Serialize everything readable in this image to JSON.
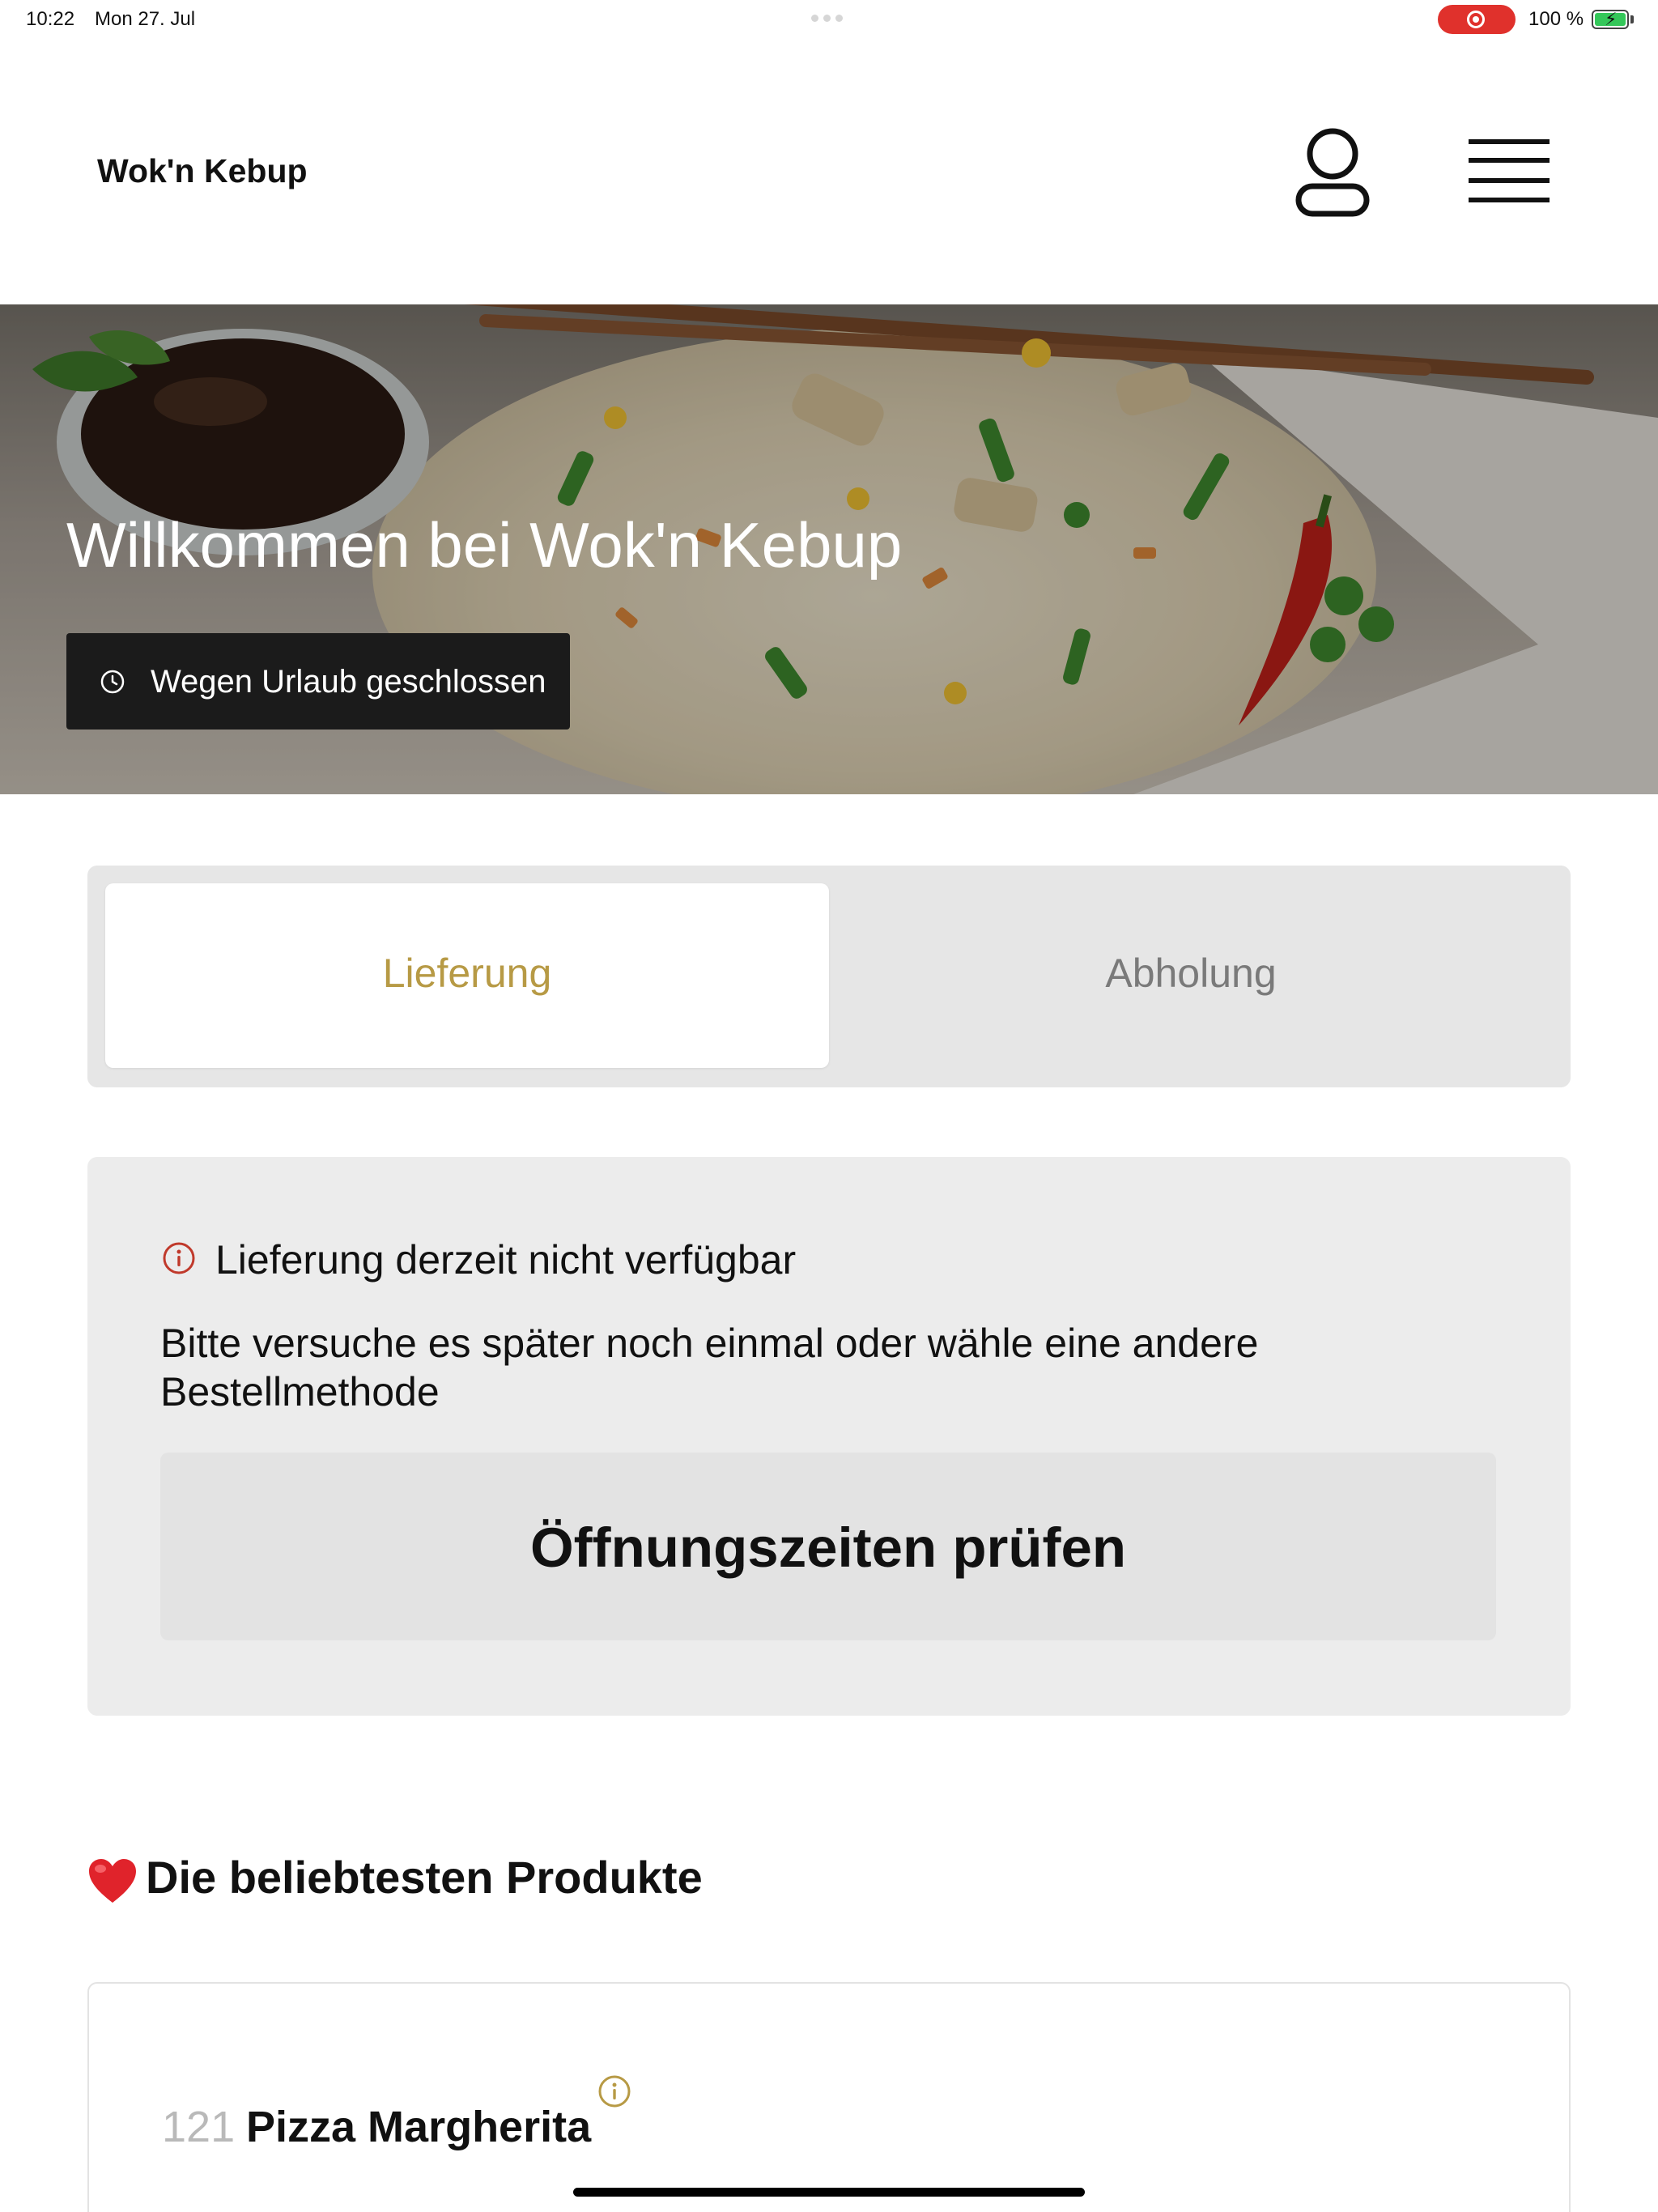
{
  "status_bar": {
    "time": "10:22",
    "date": "Mon 27. Jul",
    "battery_percent": "100 %",
    "recording": true
  },
  "header": {
    "brand": "Wok'n Kebup",
    "user_icon": "user-icon",
    "menu_icon": "hamburger-menu-icon"
  },
  "hero": {
    "title": "Willkommen bei Wok'n Kebup",
    "status_badge": "Wegen Urlaub geschlossen",
    "badge_icon": "clock-icon"
  },
  "order_method": {
    "options": [
      "Lieferung",
      "Abholung"
    ],
    "selected": "Lieferung",
    "accent_color": "#b79a45"
  },
  "notice": {
    "icon": "info-icon",
    "icon_color": "#c0392b",
    "title": "Lieferung derzeit nicht verfügbar",
    "text": "Bitte versuche es später noch einmal oder wähle eine andere Bestellmethode",
    "button_label": "Öffnungszeiten prüfen"
  },
  "popular": {
    "title": "Die beliebtesten Produkte",
    "icon": "heart-icon",
    "products": [
      {
        "number": "121",
        "name": "Pizza Margherita"
      }
    ]
  }
}
